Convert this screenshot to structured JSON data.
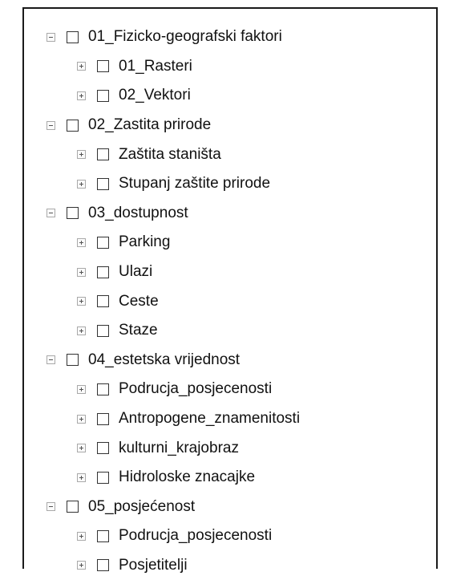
{
  "layers": [
    {
      "label": "01_Fizicko-geografski faktori",
      "expanded": true,
      "checked": false,
      "children": [
        {
          "label": "01_Rasteri",
          "expanded": false,
          "checked": false
        },
        {
          "label": "02_Vektori",
          "expanded": false,
          "checked": false
        }
      ]
    },
    {
      "label": "02_Zastita prirode",
      "expanded": true,
      "checked": false,
      "children": [
        {
          "label": "Zaštita staništa",
          "expanded": false,
          "checked": false
        },
        {
          "label": "Stupanj zaštite prirode",
          "expanded": false,
          "checked": false
        }
      ]
    },
    {
      "label": "03_dostupnost",
      "expanded": true,
      "checked": false,
      "children": [
        {
          "label": "Parking",
          "expanded": false,
          "checked": false
        },
        {
          "label": "Ulazi",
          "expanded": false,
          "checked": false
        },
        {
          "label": "Ceste",
          "expanded": false,
          "checked": false
        },
        {
          "label": "Staze",
          "expanded": false,
          "checked": false
        }
      ]
    },
    {
      "label": "04_estetska vrijednost",
      "expanded": true,
      "checked": false,
      "children": [
        {
          "label": "Podrucja_posjecenosti",
          "expanded": false,
          "checked": false
        },
        {
          "label": "Antropogene_znamenitosti",
          "expanded": false,
          "checked": false
        },
        {
          "label": "kulturni_krajobraz",
          "expanded": false,
          "checked": false
        },
        {
          "label": "Hidroloske znacajke",
          "expanded": false,
          "checked": false
        }
      ]
    },
    {
      "label": "05_posjećenost",
      "expanded": true,
      "checked": false,
      "children": [
        {
          "label": "Podrucja_posjecenosti",
          "expanded": false,
          "checked": false
        },
        {
          "label": "Posjetitelji",
          "expanded": false,
          "checked": false
        }
      ]
    }
  ]
}
